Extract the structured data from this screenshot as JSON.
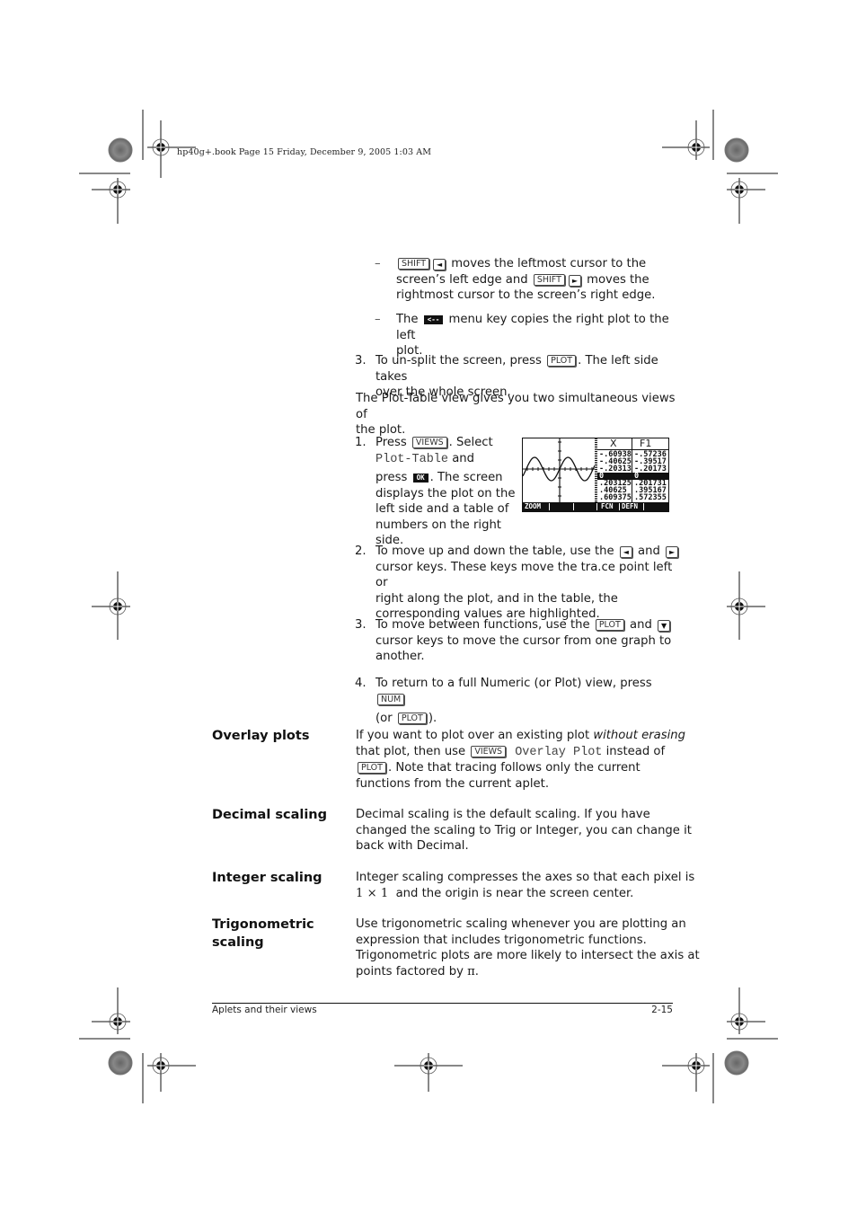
{
  "slug_line": "hp40g+.book  Page 15  Friday, December 9, 2005  1:03 AM",
  "bullets": [
    {
      "marker": "–",
      "key1": "SHIFT",
      "arrow1": "◄",
      "text1": "moves the leftmost cursor to the",
      "text2a": "screen’s left edge and",
      "key2": "SHIFT",
      "arrow2": "►",
      "text2b": "moves the",
      "text3": "rightmost cursor to the screen’s right edge."
    },
    {
      "marker": "–",
      "text_before": "The",
      "softkey": "<--",
      "text_after": "menu key copies the right plot to the left",
      "text2": "plot."
    }
  ],
  "step_unsplit": {
    "number": "3.",
    "text_before": "To un-split the screen, press",
    "key": "PLOT",
    "text_after": ". The left side takes",
    "text2": "over the whole screen."
  },
  "intro_paragraph": {
    "line1": "The Plot-Table view gives you two simultaneous views of",
    "line2": "the plot."
  },
  "steps": [
    {
      "number": "1.",
      "l1a": "Press",
      "key": "VIEWS",
      "l1b": ". Select",
      "mono": "Plot-Table",
      "l2b": "and",
      "l3a": "press",
      "softkey": "OK",
      "l3b": ". The screen",
      "l4": "displays the plot on the",
      "l5": "left side and a table of",
      "l6": "numbers on the right side."
    },
    {
      "number": "2.",
      "l1a": "To move up and down the table, use the",
      "arrow1": "◄",
      "l1b": "and",
      "arrow2": "►",
      "l2": "cursor keys. These keys move the tra.ce point left or",
      "l3": "right along the plot, and in the table, the",
      "l4": "corresponding values are highlighted."
    },
    {
      "number": "3.",
      "l1a": "To move between functions, use the",
      "key": "PLOT",
      "l1b": "and",
      "arrow": "▼",
      "l2": "cursor keys to move the cursor from one graph to",
      "l3": "another."
    },
    {
      "number": "4.",
      "l1a": "To return to a full Numeric (or Plot) view, press",
      "key1": "NUM",
      "l2a": "(or",
      "key2": "PLOT",
      "l2b": ")."
    }
  ],
  "calculator_screen": {
    "headers": [
      "X",
      "F1"
    ],
    "rows": [
      [
        "-.60938",
        "-.57236"
      ],
      [
        "-.40625",
        "-.39517"
      ],
      [
        "-.20313",
        "-.20173"
      ],
      [
        "0",
        "0"
      ],
      [
        ".203125",
        ".201731"
      ],
      [
        ".40625",
        ".395167"
      ],
      [
        ".609375",
        ".572355"
      ]
    ],
    "highlighted_row": 3,
    "menu": [
      "ZOOM",
      "",
      "",
      "FCN",
      "DEFN",
      ""
    ]
  },
  "sections": [
    {
      "heading": [
        "Overlay plots"
      ],
      "lines": [
        {
          "parts": [
            {
              "t": "If you want to plot over an existing plot "
            },
            {
              "t": "without erasing",
              "i": true
            }
          ]
        },
        {
          "parts": [
            {
              "t": "that plot, then use "
            },
            {
              "k": "VIEWS"
            },
            {
              "m": " Overlay Plot"
            },
            {
              "t": " instead of"
            }
          ]
        },
        {
          "parts": [
            {
              "k": "PLOT"
            },
            {
              "t": ". Note that tracing follows only the current"
            }
          ]
        },
        {
          "parts": [
            {
              "t": "functions from the current aplet."
            }
          ]
        }
      ]
    },
    {
      "heading": [
        "Decimal scaling"
      ],
      "lines": [
        {
          "parts": [
            {
              "t": "Decimal scaling is the default scaling. If you have"
            }
          ]
        },
        {
          "parts": [
            {
              "t": "changed the scaling to Trig or Integer, you can change it"
            }
          ]
        },
        {
          "parts": [
            {
              "t": "back with Decimal."
            }
          ]
        }
      ]
    },
    {
      "heading": [
        "Integer scaling"
      ],
      "lines": [
        {
          "parts": [
            {
              "t": "Integer scaling compresses the axes so that each pixel is"
            }
          ]
        },
        {
          "parts": [
            {
              "s": "1 × 1"
            },
            {
              "t": "  and the origin is near the screen center."
            }
          ]
        }
      ]
    },
    {
      "heading": [
        "Trigonometric",
        "scaling"
      ],
      "lines": [
        {
          "parts": [
            {
              "t": "Use trigonometric scaling whenever you are plotting an"
            }
          ]
        },
        {
          "parts": [
            {
              "t": "expression that includes trigonometric functions."
            }
          ]
        },
        {
          "parts": [
            {
              "t": "Trigonometric plots are more likely to intersect the axis at"
            }
          ]
        },
        {
          "parts": [
            {
              "t": "points factored by "
            },
            {
              "s": "π"
            },
            {
              "t": "."
            }
          ]
        }
      ]
    }
  ],
  "footer": {
    "left": "Aplets and their views",
    "right": "2-15"
  }
}
